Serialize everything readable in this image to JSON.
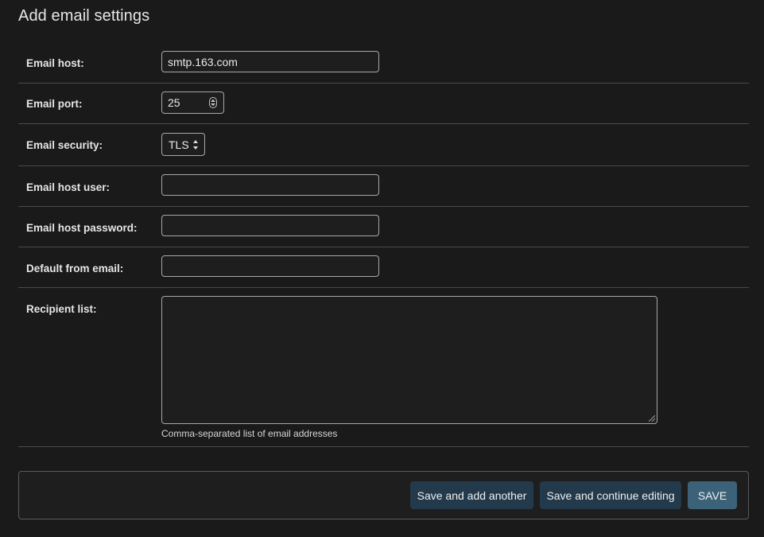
{
  "page": {
    "title": "Add email settings"
  },
  "fields": {
    "email_host": {
      "label": "Email host:",
      "value": "smtp.163.com"
    },
    "email_port": {
      "label": "Email port:",
      "value": "25"
    },
    "email_security": {
      "label": "Email security:",
      "value": "TLS"
    },
    "email_host_user": {
      "label": "Email host user:",
      "value": ""
    },
    "email_host_password": {
      "label": "Email host password:",
      "value": ""
    },
    "default_from_email": {
      "label": "Default from email:",
      "value": ""
    },
    "recipient_list": {
      "label": "Recipient list:",
      "value": "",
      "help": "Comma-separated list of email addresses"
    }
  },
  "actions": {
    "save_add_another": "Save and add another",
    "save_continue": "Save and continue editing",
    "save": "SAVE"
  },
  "colors": {
    "background": "#1a1a1a",
    "secondary_button": "#223a4b",
    "primary_button": "#3b6278"
  }
}
